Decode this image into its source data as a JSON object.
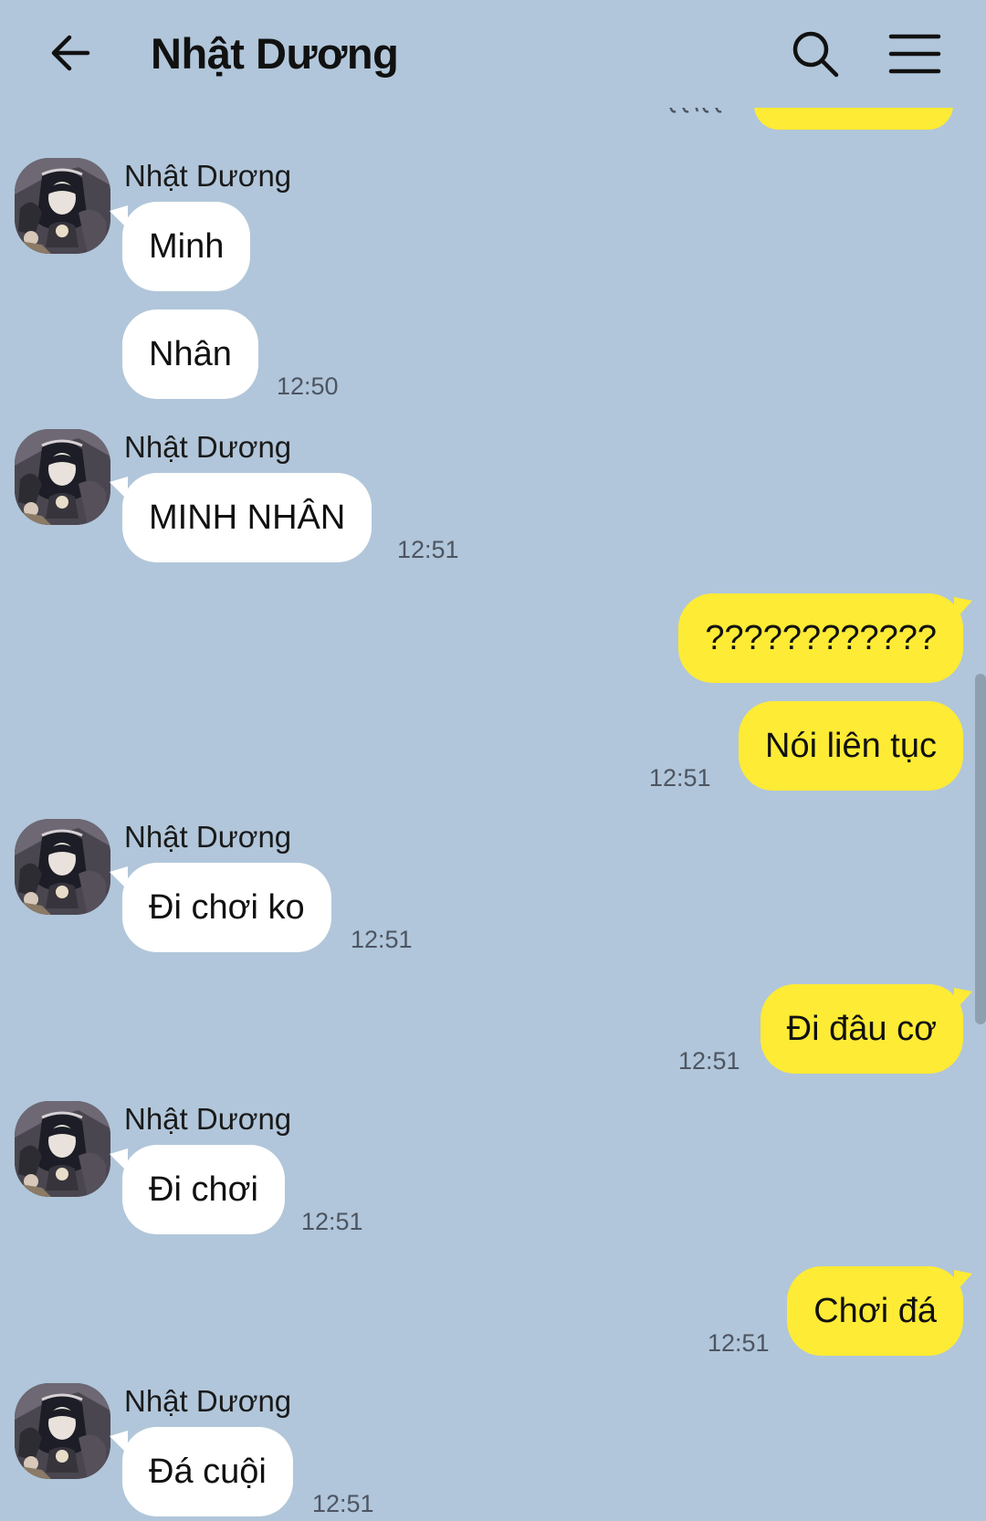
{
  "header": {
    "title": "Nhật Dương",
    "back_icon": "arrow-left-icon",
    "search_icon": "search-icon",
    "menu_icon": "hamburger-menu-icon"
  },
  "colors": {
    "background": "#B1C6DA",
    "incoming_bubble": "#FFFFFF",
    "outgoing_bubble": "#FEEB35",
    "timestamp": "#4D5562"
  },
  "messages": [
    {
      "sender": "Nhật Dương",
      "text": "Minh"
    },
    {
      "text": "Nhân",
      "time": "12:50"
    },
    {
      "sender": "Nhật Dương",
      "text": "MINH NHÂN",
      "time": "12:51"
    },
    {
      "text": "????????????"
    },
    {
      "text": "Nói liên tục",
      "time": "12:51"
    },
    {
      "sender": "Nhật Dương",
      "text": "Đi chơi ko",
      "time": "12:51"
    },
    {
      "text": "Đi đâu cơ",
      "time": "12:51"
    },
    {
      "sender": "Nhật Dương",
      "text": "Đi chơi",
      "time": "12:51"
    },
    {
      "text": "Chơi đá",
      "time": "12:51"
    },
    {
      "sender": "Nhật Dương",
      "text": "Đá cuội",
      "time": "12:51"
    }
  ]
}
